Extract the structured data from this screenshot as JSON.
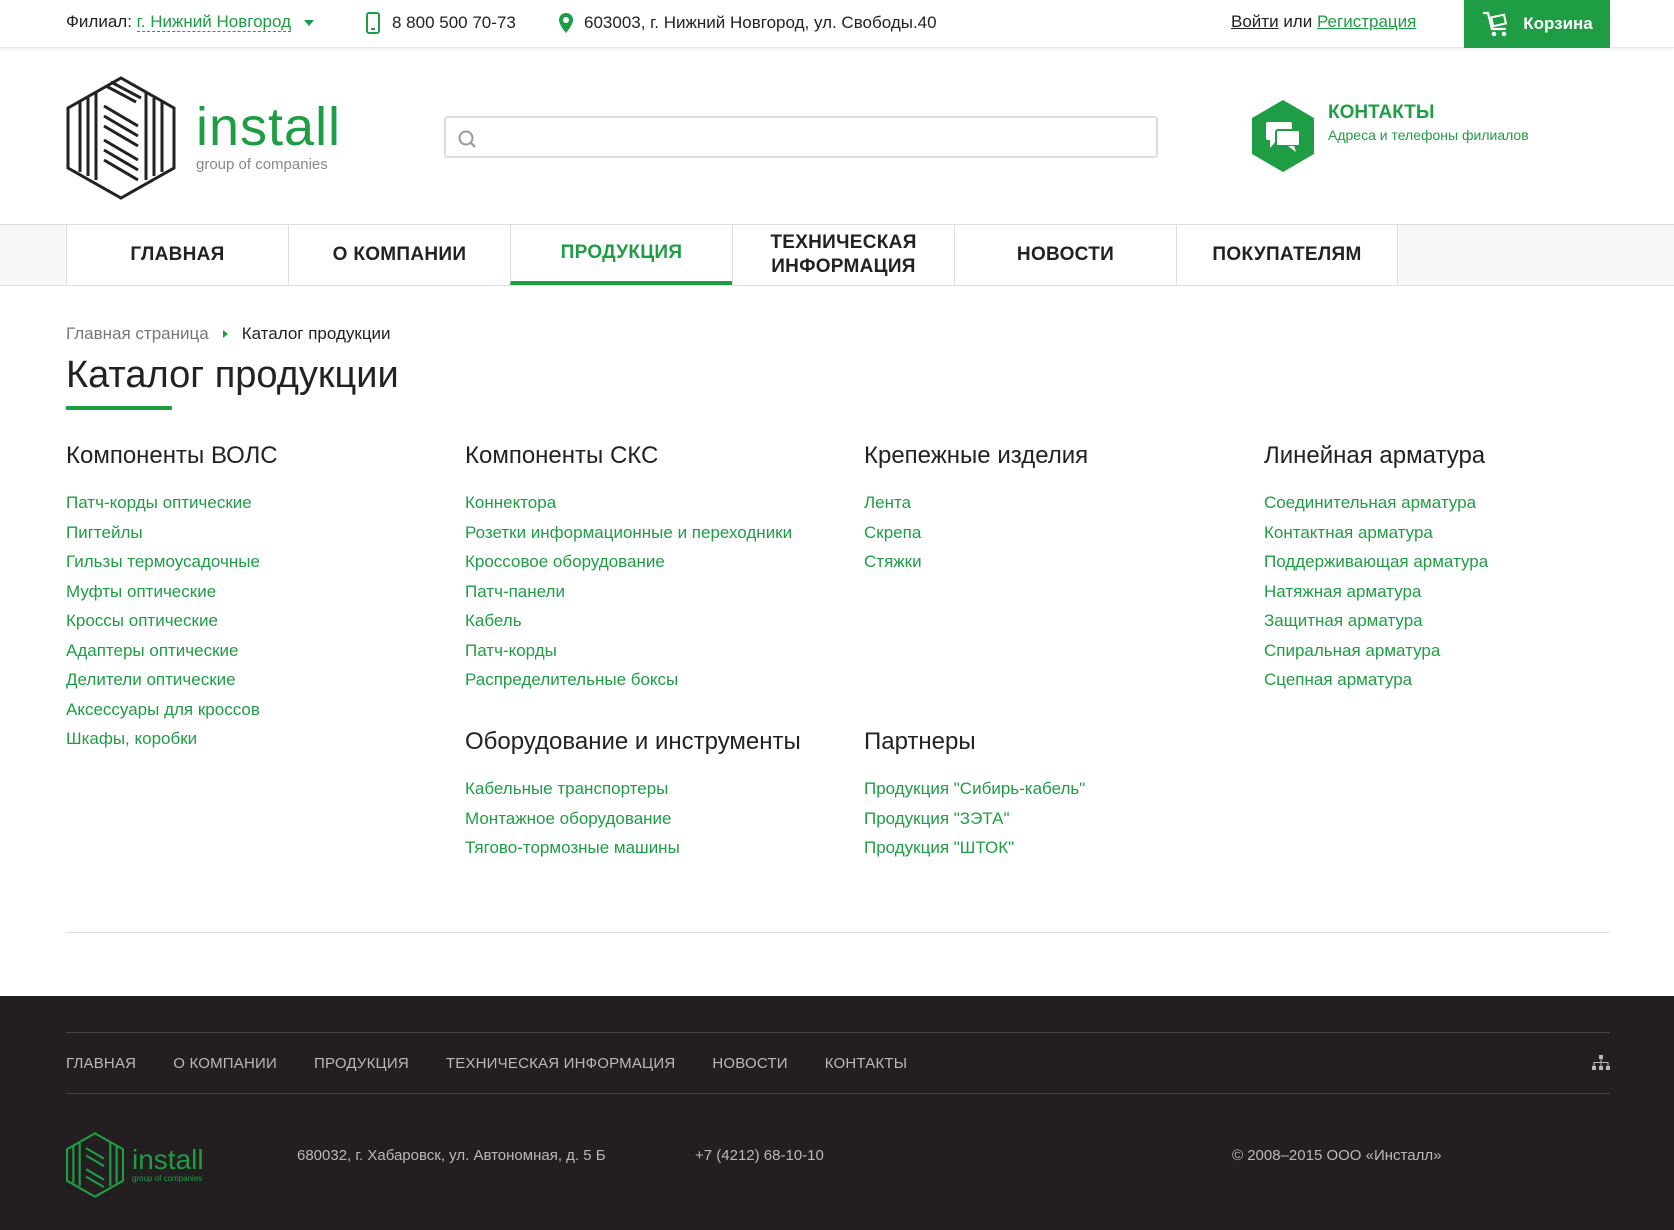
{
  "topbar": {
    "branch_label": "Филиал:",
    "branch_city": "г. Нижний Новгород",
    "phone": "8 800 500 70-73",
    "address": "603003, г. Нижний Новгород, ул. Свободы.40",
    "login": "Войти",
    "or": "или",
    "register": "Регистрация",
    "cart": "Корзина"
  },
  "header": {
    "logo_word": "install",
    "logo_tagline": "group of companies",
    "search_placeholder": "",
    "contacts_title": "КОНТАКТЫ",
    "contacts_sub": "Адреса и телефоны филиалов"
  },
  "nav": {
    "items": [
      "ГЛАВНАЯ",
      "О КОМПАНИИ",
      "ПРОДУКЦИЯ",
      "ТЕХНИЧЕСКАЯ ИНФОРМАЦИЯ",
      "НОВОСТИ",
      "ПОКУПАТЕЛЯМ"
    ],
    "active": "ПРОДУКЦИЯ"
  },
  "breadcrumb": {
    "home": "Главная страница",
    "current": "Каталог продукции"
  },
  "page_title": "Каталог продукции",
  "catalog": {
    "vols": {
      "title": "Компоненты ВОЛС",
      "items": [
        "Патч-корды оптические",
        "Пигтейлы",
        "Гильзы термоусадочные",
        "Муфты оптические",
        "Кроссы оптические",
        "Адаптеры оптические",
        "Делители оптические",
        "Аксессуары для кроссов",
        "Шкафы, коробки"
      ]
    },
    "scs": {
      "title": "Компоненты СКС",
      "items": [
        "Коннектора",
        "Розетки информационные и переходники",
        "Кроссовое оборудование",
        "Патч-панели",
        "Кабель",
        "Патч-корды",
        "Распределительные боксы"
      ]
    },
    "fasteners": {
      "title": "Крепежные изделия",
      "items": [
        "Лента",
        "Скрепа",
        "Стяжки"
      ]
    },
    "line": {
      "title": "Линейная арматура",
      "items": [
        "Соединительная арматура",
        "Контактная арматура",
        "Поддерживающая арматура",
        "Натяжная арматура",
        "Защитная арматура",
        "Спиральная арматура",
        "Сцепная арматура"
      ]
    },
    "tools": {
      "title": "Оборудование и инструменты",
      "items": [
        "Кабельные транспортеры",
        "Монтажное оборудование",
        "Тягово-тормозные машины"
      ]
    },
    "partners": {
      "title": "Партнеры",
      "items": [
        "Продукция \"Сибирь-кабель\"",
        "Продукция \"ЗЭТА\"",
        "Продукция \"ШТОК\""
      ]
    }
  },
  "footer": {
    "nav": [
      "ГЛАВНАЯ",
      "О КОМПАНИИ",
      "ПРОДУКЦИЯ",
      "ТЕХНИЧЕСКАЯ ИНФОРМАЦИЯ",
      "НОВОСТИ",
      "КОНТАКТЫ"
    ],
    "logo_word": "install",
    "logo_tagline": "group of companies",
    "address": "680032, г. Хабаровск, ул. Автономная, д. 5 Б",
    "phone": "+7 (4212) 68-10-10",
    "copyright": "© 2008–2015 ООО «Инсталл»"
  },
  "colors": {
    "accent": "#1f9d45",
    "footer_bg": "#231f20"
  },
  "icons": [
    "phone-icon",
    "location-pin-icon",
    "cart-icon",
    "search-icon",
    "chat-bubbles-icon",
    "sitemap-icon"
  ]
}
